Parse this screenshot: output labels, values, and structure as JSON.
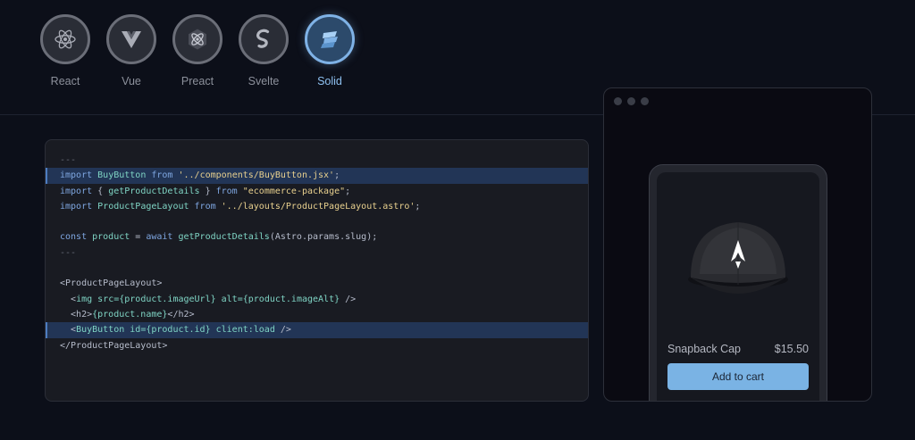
{
  "frameworks": [
    {
      "label": "React",
      "icon": "react-icon",
      "active": false
    },
    {
      "label": "Vue",
      "icon": "vue-icon",
      "active": false
    },
    {
      "label": "Preact",
      "icon": "preact-icon",
      "active": false
    },
    {
      "label": "Svelte",
      "icon": "svelte-icon",
      "active": false
    },
    {
      "label": "Solid",
      "icon": "solid-icon",
      "active": true
    }
  ],
  "code": {
    "lines": [
      {
        "tokens": [
          {
            "t": "---",
            "c": "c"
          }
        ],
        "highlight": false
      },
      {
        "tokens": [
          {
            "t": "import ",
            "c": "k"
          },
          {
            "t": "BuyButton ",
            "c": "f"
          },
          {
            "t": "from ",
            "c": "k"
          },
          {
            "t": "'../components/BuyButton.jsx'",
            "c": "s"
          },
          {
            "t": ";",
            "c": "t"
          }
        ],
        "highlight": true
      },
      {
        "tokens": [
          {
            "t": "import ",
            "c": "k"
          },
          {
            "t": "{ ",
            "c": "t"
          },
          {
            "t": "getProductDetails",
            "c": "f"
          },
          {
            "t": " } ",
            "c": "t"
          },
          {
            "t": "from ",
            "c": "k"
          },
          {
            "t": "\"ecommerce-package\"",
            "c": "s"
          },
          {
            "t": ";",
            "c": "t"
          }
        ],
        "highlight": false
      },
      {
        "tokens": [
          {
            "t": "import ",
            "c": "k"
          },
          {
            "t": "ProductPageLayout ",
            "c": "f"
          },
          {
            "t": "from ",
            "c": "k"
          },
          {
            "t": "'../layouts/ProductPageLayout.astro'",
            "c": "s"
          },
          {
            "t": ";",
            "c": "t"
          }
        ],
        "highlight": false
      },
      {
        "tokens": [],
        "highlight": false
      },
      {
        "tokens": [
          {
            "t": "const ",
            "c": "k"
          },
          {
            "t": "product ",
            "c": "f"
          },
          {
            "t": "= ",
            "c": "t"
          },
          {
            "t": "await ",
            "c": "k"
          },
          {
            "t": "getProductDetails",
            "c": "f"
          },
          {
            "t": "(Astro.params.slug);",
            "c": "t"
          }
        ],
        "highlight": false
      },
      {
        "tokens": [
          {
            "t": "---",
            "c": "c"
          }
        ],
        "highlight": false
      },
      {
        "tokens": [],
        "highlight": false
      },
      {
        "tokens": [
          {
            "t": "<ProductPageLayout>",
            "c": "t"
          }
        ],
        "highlight": false
      },
      {
        "tokens": [
          {
            "t": "  <",
            "c": "t"
          },
          {
            "t": "img ",
            "c": "f"
          },
          {
            "t": "src=",
            "c": "f"
          },
          {
            "t": "{product.imageUrl} ",
            "c": "f"
          },
          {
            "t": "alt=",
            "c": "f"
          },
          {
            "t": "{product.imageAlt}",
            "c": "f"
          },
          {
            "t": " />",
            "c": "t"
          }
        ],
        "highlight": false
      },
      {
        "tokens": [
          {
            "t": "  <h2>",
            "c": "t"
          },
          {
            "t": "{product.name}",
            "c": "f"
          },
          {
            "t": "</h2>",
            "c": "t"
          }
        ],
        "highlight": false
      },
      {
        "tokens": [
          {
            "t": "  <",
            "c": "t"
          },
          {
            "t": "BuyButton ",
            "c": "f"
          },
          {
            "t": "id=",
            "c": "f"
          },
          {
            "t": "{product.id} ",
            "c": "f"
          },
          {
            "t": "client:load",
            "c": "f"
          },
          {
            "t": " />",
            "c": "t"
          }
        ],
        "highlight": true
      },
      {
        "tokens": [
          {
            "t": "</ProductPageLayout>",
            "c": "t"
          }
        ],
        "highlight": false
      }
    ]
  },
  "product": {
    "name": "Snapback Cap",
    "price": "$15.50",
    "button_label": "Add to cart",
    "image_icon": "cap-icon"
  },
  "colors": {
    "accent": "#7ab3e4",
    "background": "#0c0f19",
    "highlight": "#223556"
  }
}
